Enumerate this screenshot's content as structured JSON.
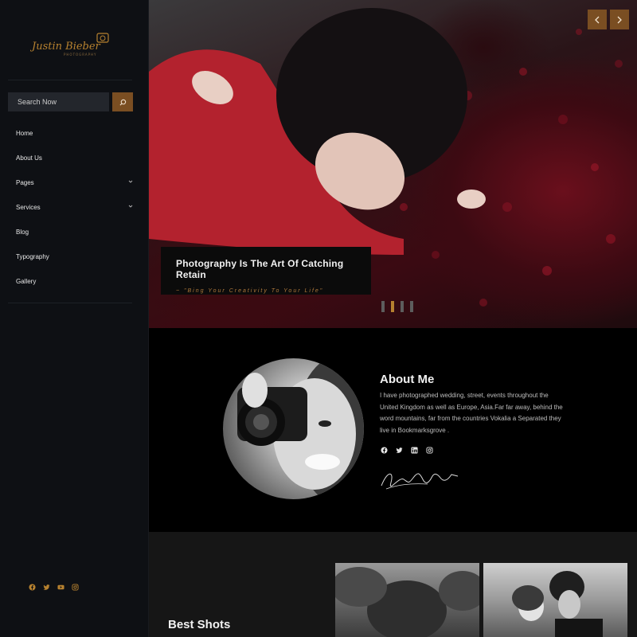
{
  "brand": {
    "logo_text": "Justin Bieber",
    "logo_subtext": "PHOTOGRAPHY"
  },
  "search": {
    "placeholder": "Search Now"
  },
  "nav": [
    {
      "label": "Home",
      "has_submenu": false
    },
    {
      "label": "About Us",
      "has_submenu": false
    },
    {
      "label": "Pages",
      "has_submenu": true
    },
    {
      "label": "Services",
      "has_submenu": true
    },
    {
      "label": "Blog",
      "has_submenu": false
    },
    {
      "label": "Typography",
      "has_submenu": false
    },
    {
      "label": "Gallery",
      "has_submenu": false
    }
  ],
  "sidebar_socials": [
    "facebook-icon",
    "twitter-icon",
    "youtube-icon",
    "instagram-icon"
  ],
  "hero": {
    "title": "Photography Is The Art Of Catching Retain",
    "subtitle": "~ \"Bing Your Creativity To Your Life\"",
    "slide_count": 4,
    "active_slide": 2
  },
  "about": {
    "title": "About Me",
    "text": "I have photographed wedding, street, events throughout the United Kingdom as well as Europe, Asia.Far far away, behind the word mountains, far from the countries Vokalia a Separated they live in Bookmarksgrove .",
    "socials": [
      "facebook-icon",
      "twitter-icon",
      "linkedin-icon",
      "instagram-icon"
    ]
  },
  "shots": {
    "title": "Best Shots"
  },
  "colors": {
    "accent": "#7a4e22",
    "gold": "#b6812f",
    "sidebar_bg": "#0e1014"
  }
}
